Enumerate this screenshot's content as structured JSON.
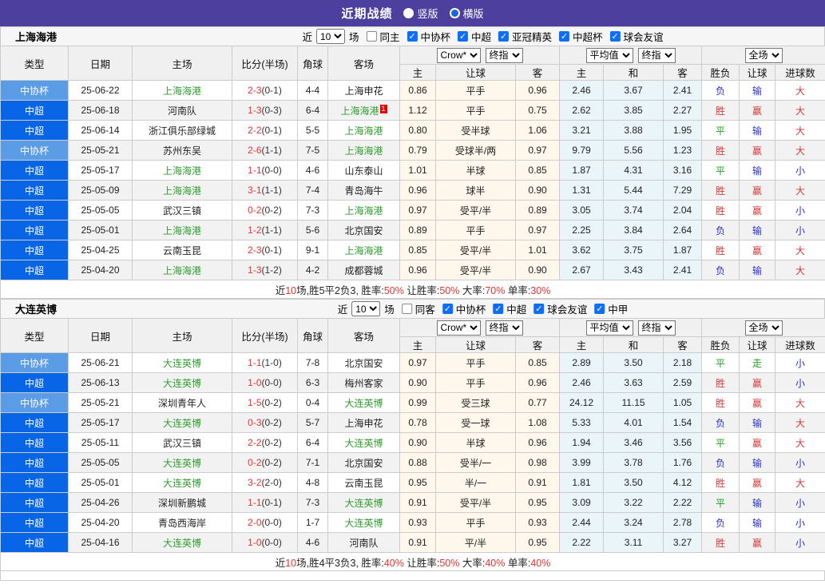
{
  "header": {
    "title": "近期战绩",
    "radio_vertical": "竖版",
    "radio_horizontal": "横版"
  },
  "colors": {
    "topbar": "#4c3f9e",
    "league": "#0866e6",
    "cup": "#5b9ce6",
    "team_green": "#2e9e2e",
    "score_red": "#e63333",
    "win_red": "#d43a3a",
    "lose_blue": "#2b32c8",
    "draw_green": "#1fa11f",
    "cream": "#fdf7ec",
    "light_blue": "#eaf5fa",
    "checkbox_blue": "#0d6efd"
  },
  "columns": {
    "main": [
      "类型",
      "日期",
      "主场",
      "比分(半场)",
      "角球",
      "客场"
    ],
    "sub": [
      "主",
      "让球",
      "客",
      "主",
      "和",
      "客",
      "胜负",
      "让球",
      "进球数"
    ],
    "selects": {
      "odds": [
        "Crow*",
        "终指"
      ],
      "avg": [
        "平均值",
        "终指"
      ],
      "result": [
        "全场"
      ]
    }
  },
  "sections": [
    {
      "team": "上海海港",
      "filter": {
        "near_label": "近",
        "count": "10",
        "games_label": "场",
        "same_label": "同主",
        "competitions": [
          "中协杯",
          "中超",
          "亚冠精英",
          "中超杯",
          "球会友谊"
        ]
      },
      "rows": [
        {
          "type": "中协杯",
          "cup": true,
          "date": "25-06-22",
          "home": "上海海港",
          "home_green": true,
          "away": "上海申花",
          "away_green": false,
          "score": "2-3",
          "half": "(0-1)",
          "corner": "4-4",
          "let": [
            "0.86",
            "平手",
            "0.96"
          ],
          "avg": [
            "2.46",
            "3.67",
            "2.41"
          ],
          "res": [
            [
              "负",
              "b"
            ],
            [
              "输",
              "b"
            ],
            [
              "大",
              "r"
            ]
          ]
        },
        {
          "type": "中超",
          "cup": false,
          "date": "25-06-18",
          "home": "河南队",
          "home_green": false,
          "away": "上海海港",
          "away_green": true,
          "badge": "1",
          "score": "1-3",
          "half": "(0-3)",
          "corner": "6-4",
          "let": [
            "1.12",
            "平手",
            "0.75"
          ],
          "avg": [
            "2.62",
            "3.85",
            "2.27"
          ],
          "res": [
            [
              "胜",
              "r"
            ],
            [
              "赢",
              "r"
            ],
            [
              "大",
              "r"
            ]
          ]
        },
        {
          "type": "中超",
          "cup": false,
          "date": "25-06-14",
          "home": "浙江俱乐部绿城",
          "home_green": false,
          "away": "上海海港",
          "away_green": true,
          "score": "2-2",
          "half": "(0-1)",
          "corner": "5-5",
          "let": [
            "0.80",
            "受半球",
            "1.06"
          ],
          "avg": [
            "3.21",
            "3.88",
            "1.95"
          ],
          "res": [
            [
              "平",
              "g"
            ],
            [
              "输",
              "b"
            ],
            [
              "大",
              "r"
            ]
          ]
        },
        {
          "type": "中协杯",
          "cup": true,
          "date": "25-05-21",
          "home": "苏州东吴",
          "home_green": false,
          "away": "上海海港",
          "away_green": true,
          "score": "2-6",
          "half": "(1-1)",
          "corner": "7-5",
          "let": [
            "0.79",
            "受球半/两",
            "0.97"
          ],
          "avg": [
            "9.79",
            "5.56",
            "1.23"
          ],
          "res": [
            [
              "胜",
              "r"
            ],
            [
              "赢",
              "r"
            ],
            [
              "大",
              "r"
            ]
          ]
        },
        {
          "type": "中超",
          "cup": false,
          "date": "25-05-17",
          "home": "上海海港",
          "home_green": true,
          "away": "山东泰山",
          "away_green": false,
          "score": "1-1",
          "half": "(0-0)",
          "corner": "4-6",
          "let": [
            "1.01",
            "半球",
            "0.85"
          ],
          "avg": [
            "1.87",
            "4.31",
            "3.16"
          ],
          "res": [
            [
              "平",
              "g"
            ],
            [
              "输",
              "b"
            ],
            [
              "小",
              "b"
            ]
          ]
        },
        {
          "type": "中超",
          "cup": false,
          "date": "25-05-09",
          "home": "上海海港",
          "home_green": true,
          "away": "青岛海牛",
          "away_green": false,
          "score": "3-1",
          "half": "(1-1)",
          "corner": "7-4",
          "let": [
            "0.96",
            "球半",
            "0.90"
          ],
          "avg": [
            "1.31",
            "5.44",
            "7.29"
          ],
          "res": [
            [
              "胜",
              "r"
            ],
            [
              "赢",
              "r"
            ],
            [
              "大",
              "r"
            ]
          ]
        },
        {
          "type": "中超",
          "cup": false,
          "date": "25-05-05",
          "home": "武汉三镇",
          "home_green": false,
          "away": "上海海港",
          "away_green": true,
          "score": "0-2",
          "half": "(0-2)",
          "corner": "7-3",
          "let": [
            "0.97",
            "受平/半",
            "0.89"
          ],
          "avg": [
            "3.05",
            "3.74",
            "2.04"
          ],
          "res": [
            [
              "胜",
              "r"
            ],
            [
              "赢",
              "r"
            ],
            [
              "小",
              "b"
            ]
          ]
        },
        {
          "type": "中超",
          "cup": false,
          "date": "25-05-01",
          "home": "上海海港",
          "home_green": true,
          "away": "北京国安",
          "away_green": false,
          "score": "1-2",
          "half": "(1-1)",
          "corner": "5-6",
          "let": [
            "0.89",
            "平手",
            "0.97"
          ],
          "avg": [
            "2.25",
            "3.84",
            "2.64"
          ],
          "res": [
            [
              "负",
              "b"
            ],
            [
              "输",
              "b"
            ],
            [
              "小",
              "b"
            ]
          ]
        },
        {
          "type": "中超",
          "cup": false,
          "date": "25-04-25",
          "home": "云南玉昆",
          "home_green": false,
          "away": "上海海港",
          "away_green": true,
          "score": "2-3",
          "half": "(0-1)",
          "corner": "9-1",
          "let": [
            "0.85",
            "受平/半",
            "1.01"
          ],
          "avg": [
            "3.62",
            "3.75",
            "1.87"
          ],
          "res": [
            [
              "胜",
              "r"
            ],
            [
              "赢",
              "r"
            ],
            [
              "大",
              "r"
            ]
          ]
        },
        {
          "type": "中超",
          "cup": false,
          "date": "25-04-20",
          "home": "上海海港",
          "home_green": true,
          "away": "成都蓉城",
          "away_green": false,
          "score": "1-3",
          "half": "(1-2)",
          "corner": "4-2",
          "let": [
            "0.96",
            "受平/半",
            "0.90"
          ],
          "avg": [
            "2.67",
            "3.43",
            "2.41"
          ],
          "res": [
            [
              "负",
              "b"
            ],
            [
              "输",
              "b"
            ],
            [
              "大",
              "r"
            ]
          ]
        }
      ],
      "summary": [
        [
          "近",
          0
        ],
        [
          "10",
          1
        ],
        [
          "场,胜5平2负3, 胜率:",
          0
        ],
        [
          "50%",
          1
        ],
        [
          " 让胜率:",
          0
        ],
        [
          "50%",
          1
        ],
        [
          " 大率:",
          0
        ],
        [
          "70%",
          1
        ],
        [
          " 单率:",
          0
        ],
        [
          "30%",
          1
        ]
      ]
    },
    {
      "team": "大连英博",
      "filter": {
        "near_label": "近",
        "count": "10",
        "games_label": "场",
        "same_label": "同客",
        "competitions": [
          "中协杯",
          "中超",
          "球会友谊",
          "中甲"
        ]
      },
      "rows": [
        {
          "type": "中协杯",
          "cup": true,
          "date": "25-06-21",
          "home": "大连英博",
          "home_green": true,
          "away": "北京国安",
          "away_green": false,
          "score": "1-1",
          "half": "(1-0)",
          "corner": "7-8",
          "let": [
            "0.97",
            "平手",
            "0.85"
          ],
          "avg": [
            "2.89",
            "3.50",
            "2.18"
          ],
          "res": [
            [
              "平",
              "g"
            ],
            [
              "走",
              "g"
            ],
            [
              "小",
              "b"
            ]
          ]
        },
        {
          "type": "中超",
          "cup": false,
          "date": "25-06-13",
          "home": "大连英博",
          "home_green": true,
          "away": "梅州客家",
          "away_green": false,
          "score": "1-0",
          "half": "(0-0)",
          "corner": "6-3",
          "let": [
            "0.90",
            "平手",
            "0.96"
          ],
          "avg": [
            "2.46",
            "3.63",
            "2.59"
          ],
          "res": [
            [
              "胜",
              "r"
            ],
            [
              "赢",
              "r"
            ],
            [
              "小",
              "b"
            ]
          ]
        },
        {
          "type": "中协杯",
          "cup": true,
          "date": "25-05-21",
          "home": "深圳青年人",
          "home_green": false,
          "away": "大连英博",
          "away_green": true,
          "score": "1-5",
          "half": "(0-2)",
          "corner": "0-4",
          "let": [
            "0.99",
            "受三球",
            "0.77"
          ],
          "avg": [
            "24.12",
            "11.15",
            "1.05"
          ],
          "res": [
            [
              "胜",
              "r"
            ],
            [
              "赢",
              "r"
            ],
            [
              "大",
              "r"
            ]
          ]
        },
        {
          "type": "中超",
          "cup": false,
          "date": "25-05-17",
          "home": "大连英博",
          "home_green": true,
          "away": "上海申花",
          "away_green": false,
          "score": "0-3",
          "half": "(0-2)",
          "corner": "5-7",
          "let": [
            "0.78",
            "受一球",
            "1.08"
          ],
          "avg": [
            "5.33",
            "4.01",
            "1.54"
          ],
          "res": [
            [
              "负",
              "b"
            ],
            [
              "输",
              "b"
            ],
            [
              "大",
              "r"
            ]
          ]
        },
        {
          "type": "中超",
          "cup": false,
          "date": "25-05-11",
          "home": "武汉三镇",
          "home_green": false,
          "away": "大连英博",
          "away_green": true,
          "score": "2-2",
          "half": "(0-2)",
          "corner": "6-4",
          "let": [
            "0.90",
            "半球",
            "0.96"
          ],
          "avg": [
            "1.94",
            "3.46",
            "3.56"
          ],
          "res": [
            [
              "平",
              "g"
            ],
            [
              "赢",
              "r"
            ],
            [
              "大",
              "r"
            ]
          ]
        },
        {
          "type": "中超",
          "cup": false,
          "date": "25-05-05",
          "home": "大连英博",
          "home_green": true,
          "away": "北京国安",
          "away_green": false,
          "score": "0-2",
          "half": "(0-2)",
          "corner": "7-1",
          "let": [
            "0.88",
            "受半/一",
            "0.98"
          ],
          "avg": [
            "3.99",
            "3.78",
            "1.76"
          ],
          "res": [
            [
              "负",
              "b"
            ],
            [
              "输",
              "b"
            ],
            [
              "小",
              "b"
            ]
          ]
        },
        {
          "type": "中超",
          "cup": false,
          "date": "25-05-01",
          "home": "大连英博",
          "home_green": true,
          "away": "云南玉昆",
          "away_green": false,
          "score": "3-2",
          "half": "(2-0)",
          "corner": "4-8",
          "let": [
            "0.95",
            "半/一",
            "0.91"
          ],
          "avg": [
            "1.81",
            "3.50",
            "4.12"
          ],
          "res": [
            [
              "胜",
              "r"
            ],
            [
              "赢",
              "r"
            ],
            [
              "大",
              "r"
            ]
          ]
        },
        {
          "type": "中超",
          "cup": false,
          "date": "25-04-26",
          "home": "深圳新鹏城",
          "home_green": false,
          "away": "大连英博",
          "away_green": true,
          "score": "1-1",
          "half": "(0-1)",
          "corner": "7-3",
          "let": [
            "0.91",
            "受平/半",
            "0.95"
          ],
          "avg": [
            "3.09",
            "3.22",
            "2.22"
          ],
          "res": [
            [
              "平",
              "g"
            ],
            [
              "输",
              "b"
            ],
            [
              "小",
              "b"
            ]
          ]
        },
        {
          "type": "中超",
          "cup": false,
          "date": "25-04-20",
          "home": "青岛西海岸",
          "home_green": false,
          "away": "大连英博",
          "away_green": true,
          "score": "2-0",
          "half": "(0-0)",
          "corner": "1-7",
          "let": [
            "0.93",
            "平手",
            "0.93"
          ],
          "avg": [
            "2.44",
            "3.24",
            "2.78"
          ],
          "res": [
            [
              "负",
              "b"
            ],
            [
              "输",
              "b"
            ],
            [
              "小",
              "b"
            ]
          ]
        },
        {
          "type": "中超",
          "cup": false,
          "date": "25-04-16",
          "home": "大连英博",
          "home_green": true,
          "away": "河南队",
          "away_green": false,
          "score": "1-0",
          "half": "(0-0)",
          "corner": "4-6",
          "let": [
            "0.91",
            "平/半",
            "0.95"
          ],
          "avg": [
            "2.22",
            "3.11",
            "3.27"
          ],
          "res": [
            [
              "胜",
              "r"
            ],
            [
              "赢",
              "r"
            ],
            [
              "小",
              "b"
            ]
          ]
        }
      ],
      "summary": [
        [
          "近",
          0
        ],
        [
          "10",
          1
        ],
        [
          "场,胜4平3负3, 胜率:",
          0
        ],
        [
          "40%",
          1
        ],
        [
          " 让胜率:",
          0
        ],
        [
          "50%",
          1
        ],
        [
          " 大率:",
          0
        ],
        [
          "40%",
          1
        ],
        [
          " 单率:",
          0
        ],
        [
          "40%",
          1
        ]
      ]
    }
  ]
}
